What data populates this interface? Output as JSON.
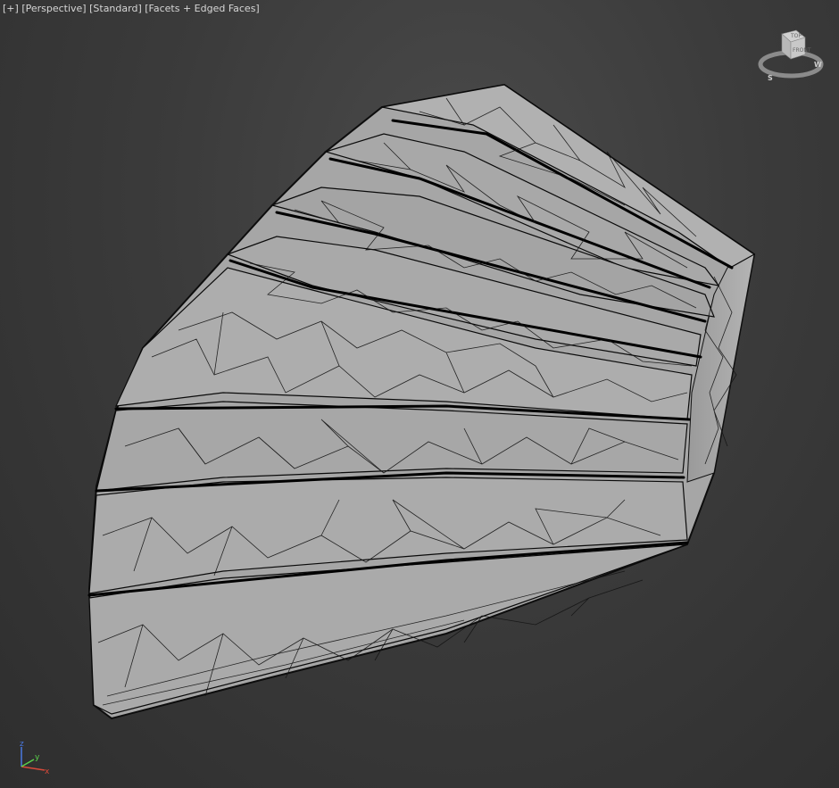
{
  "viewport": {
    "label_plus": "[+]",
    "label_view": "[Perspective]",
    "label_shading_mode": "[Standard]",
    "label_display": "[Facets + Edged Faces]"
  },
  "viewcube": {
    "top_face": "TOP",
    "front_face": "FRONT",
    "compass_s": "S",
    "compass_w": "W"
  },
  "axis_tripod": {
    "x": "x",
    "y": "y",
    "z": "z"
  },
  "colors": {
    "mesh_fill": "#a9a9a9",
    "mesh_edges": "#111111",
    "x_axis": "#d84a3a",
    "y_axis": "#5ad04a",
    "z_axis": "#4a78e0",
    "label_text": "#d6d6d6"
  }
}
